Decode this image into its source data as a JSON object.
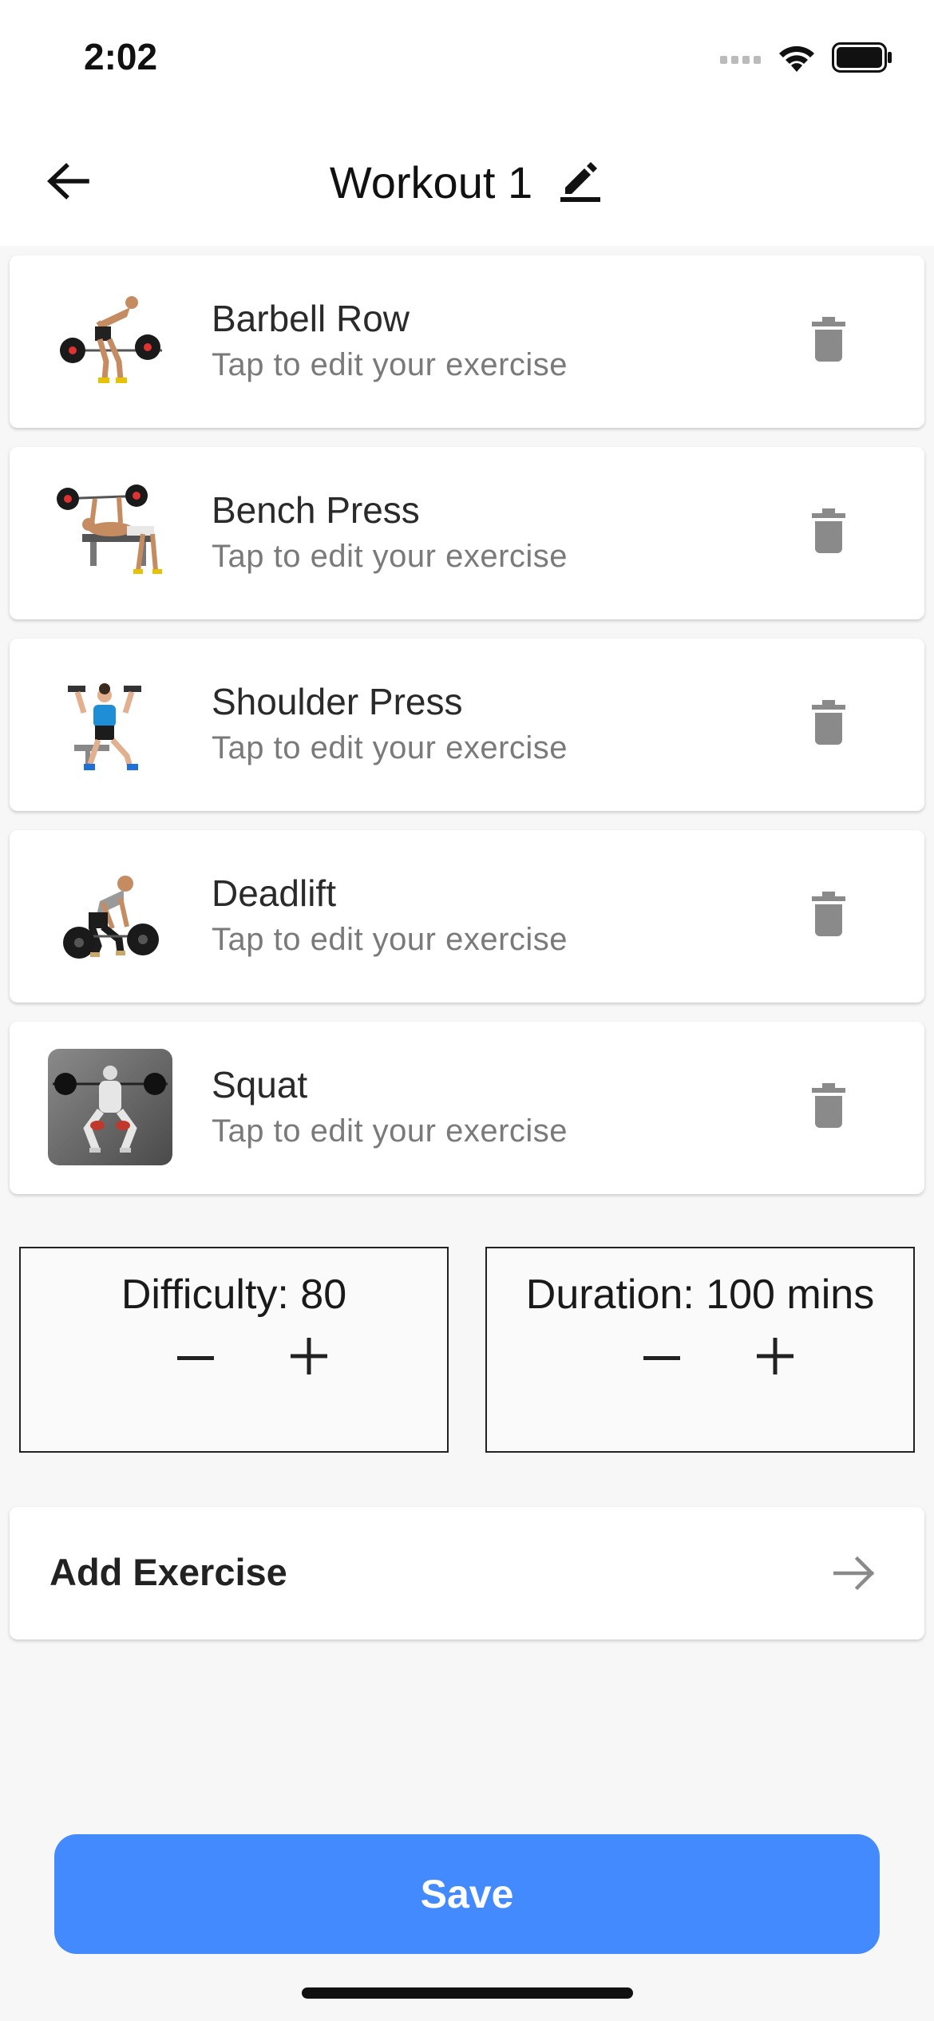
{
  "status_bar": {
    "time": "2:02",
    "icons": [
      "cellular-signal-icon",
      "wifi-icon",
      "battery-icon"
    ]
  },
  "header": {
    "title": "Workout 1",
    "back_icon": "arrow-left-icon",
    "edit_icon": "pencil-icon"
  },
  "exercises": [
    {
      "name": "Barbell Row",
      "subtitle": "Tap to edit your exercise",
      "thumbnail": "barbell-row-illustration"
    },
    {
      "name": "Bench Press",
      "subtitle": "Tap to edit your exercise",
      "thumbnail": "bench-press-illustration"
    },
    {
      "name": "Shoulder Press",
      "subtitle": "Tap to edit your exercise",
      "thumbnail": "shoulder-press-illustration"
    },
    {
      "name": "Deadlift",
      "subtitle": "Tap to edit your exercise",
      "thumbnail": "deadlift-illustration"
    },
    {
      "name": "Squat",
      "subtitle": "Tap to edit your exercise",
      "thumbnail": "squat-illustration"
    }
  ],
  "difficulty": {
    "label": "Difficulty: 80",
    "value": 80
  },
  "duration": {
    "label": "Duration: 100 mins",
    "value": 100
  },
  "add_exercise": {
    "label": "Add Exercise",
    "icon": "arrow-right-icon"
  },
  "save": {
    "label": "Save"
  },
  "colors": {
    "accent": "#448aff",
    "icon_gray": "#8a8a8a",
    "text_dark": "#222222"
  }
}
